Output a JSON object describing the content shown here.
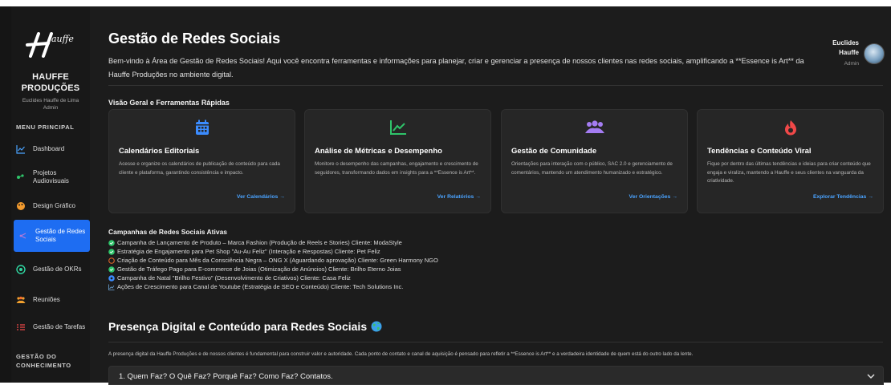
{
  "sidebar": {
    "brand_line1": "HAUFFE",
    "brand_line2": "PRODUÇÕES",
    "user_line1": "Euclides Hauffe de Lima",
    "user_line2": "Admin",
    "menu_title": "MENU PRINCIPAL",
    "items": [
      {
        "label": "Dashboard",
        "icon": "chart-line-icon"
      },
      {
        "label": "Projetos Audiovisuais",
        "icon": "film-icon"
      },
      {
        "label": "Design Gráfico",
        "icon": "palette-icon"
      },
      {
        "label": "Gestão de Redes Sociais",
        "icon": "share-icon",
        "active": true
      },
      {
        "label": "Gestão de OKRs",
        "icon": "target-icon"
      },
      {
        "label": "Reuniões",
        "icon": "users-icon"
      },
      {
        "label": "Gestão de Tarefas",
        "icon": "tasks-icon"
      }
    ],
    "knowledge_title_1": "GESTÃO DO",
    "knowledge_title_2": "CONHECIMENTO"
  },
  "header": {
    "title": "Gestão de Redes Sociais",
    "description": "Bem-vindo à Área de Gestão de Redes Sociais! Aqui você encontra ferramentas e informações para planejar, criar e gerenciar a presença de nossos clientes nas redes sociais, amplificando a **Essence is Art** da Hauffe Produções no ambiente digital.",
    "user_name_1": "Euclides",
    "user_name_2": "Hauffe",
    "user_role": "Admin"
  },
  "overview": {
    "title": "Visão Geral e Ferramentas Rápidas",
    "cards": [
      {
        "title": "Calendários Editoriais",
        "desc": "Acesse e organize os calendários de publicação de conteúdo para cada cliente e plataforma, garantindo consistência e impacto.",
        "link": "Ver Calendários →",
        "icon": "calendar-icon",
        "color": "#3b8cff"
      },
      {
        "title": "Análise de Métricas e Desempenho",
        "desc": "Monitore o desempenho das campanhas, engajamento e crescimento de seguidores, transformando dados em insights para a **Essence is Art**.",
        "link": "Ver Relatórios →",
        "icon": "chart-line-icon",
        "color": "#2fc46a"
      },
      {
        "title": "Gestão de Comunidade",
        "desc": "Orientações para interação com o público, SAC 2.0 e gerenciamento de comentários, mantendo um atendimento humanizado e estratégico.",
        "link": "Ver Orientações →",
        "icon": "users-icon",
        "color": "#a47cf2"
      },
      {
        "title": "Tendências e Conteúdo Viral",
        "desc": "Fique por dentro das últimas tendências e ideias para criar conteúdo que engaja e viraliza, mantendo a Hauffe e seus clientes na vanguarda da criatividade.",
        "link": "Explorar Tendências →",
        "icon": "fire-icon",
        "color": "#f04848"
      }
    ]
  },
  "campaigns": {
    "title": "Campanhas de Redes Sociais Ativas",
    "items": [
      {
        "text": "Campanha de Lançamento de Produto – Marca Fashion (Produção de Reels e Stories) Cliente: ModaStyle",
        "status": "check-circle-icon",
        "color": "#2fc46a"
      },
      {
        "text": "Estratégia de Engajamento para Pet Shop \"Au-Au Feliz\" (Interação e Respostas) Cliente: Pet Feliz",
        "status": "check-circle-icon",
        "color": "#2fc46a"
      },
      {
        "text": "Criação de Conteúdo para Mês da Consciência Negra – ONG X (Aguardando aprovação) Cliente: Green Harmony NGO",
        "status": "pending-circle-icon",
        "color": "#f06a2a"
      },
      {
        "text": "Gestão de Tráfego Pago para E-commerce de Joias (Otimização de Anúncios) Cliente: Brilho Eterno Joias",
        "status": "check-circle-icon",
        "color": "#2fc46a"
      },
      {
        "text": "Campanha de Natal \"Brilho Festivo\" (Desenvolvimento de Criativos) Cliente: Casa Feliz",
        "status": "progress-circle-icon",
        "color": "#3b8cff"
      },
      {
        "text": "Ações de Crescimento para Canal de Youtube (Estratégia de SEO e Conteúdo) Cliente: Tech Solutions Inc.",
        "status": "chart-line-icon",
        "color": "#6fa8dc"
      }
    ]
  },
  "presence": {
    "title": "Presença Digital e Conteúdo para Redes Sociais",
    "description": "A presença digital da Hauffe Produções e de nossos clientes é fundamental para construir valor e autoridade. Cada ponto de contato e canal de aquisição é pensado para refletir a **Essence is Art** e a verdadeira identidade de quem está do outro lado da lente.",
    "accordion_label": "1. Quem Faz? O Quê Faz? Porquê Faz? Como Faz? Contatos."
  }
}
